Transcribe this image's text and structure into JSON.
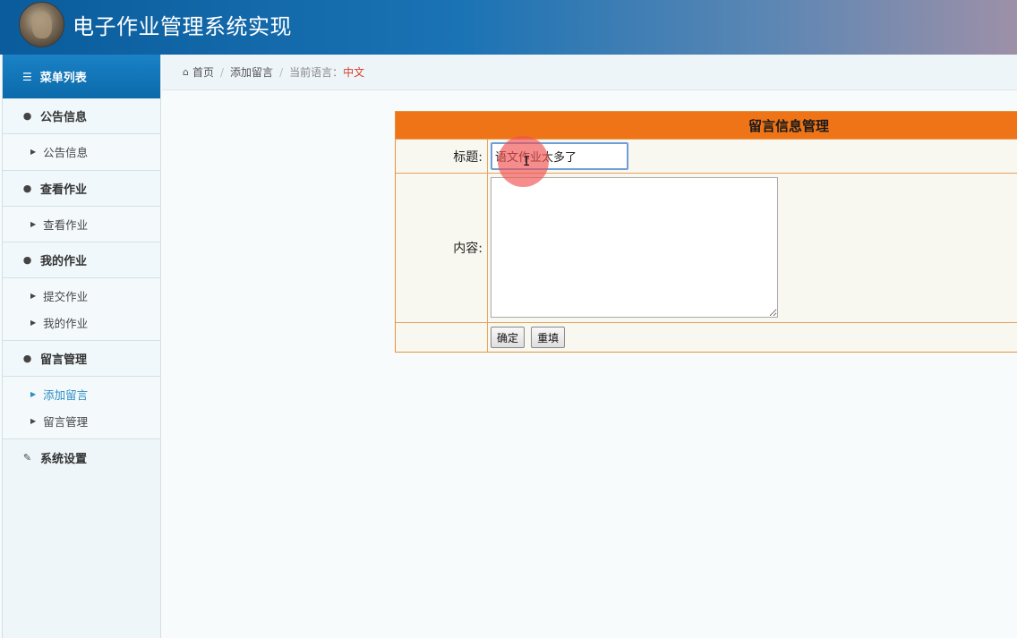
{
  "header": {
    "title": "电子作业管理系统实现"
  },
  "sidebar": {
    "menu_title": "菜单列表",
    "groups": [
      {
        "label": "公告信息",
        "items": [
          {
            "label": "公告信息"
          }
        ]
      },
      {
        "label": "查看作业",
        "items": [
          {
            "label": "查看作业"
          }
        ]
      },
      {
        "label": "我的作业",
        "items": [
          {
            "label": "提交作业"
          },
          {
            "label": "我的作业"
          }
        ]
      },
      {
        "label": "留言管理",
        "items": [
          {
            "label": "添加留言",
            "active": true
          },
          {
            "label": "留言管理"
          }
        ]
      },
      {
        "label": "系统设置",
        "items": []
      }
    ]
  },
  "breadcrumb": {
    "home": "首页",
    "current": "添加留言",
    "lang_label": "当前语言：",
    "lang_value": "中文"
  },
  "form": {
    "panel_title": "留言信息管理",
    "title_label": "标题:",
    "title_value": "语文作业太多了",
    "content_label": "内容:",
    "content_value": "",
    "submit_label": "确定",
    "reset_label": "重填"
  },
  "icons": {
    "menu": "list-icon",
    "group": "user-icon",
    "settings": "edit-icon",
    "home": "home-icon",
    "caret": "caret-right-icon"
  },
  "colors": {
    "header_start": "#0a5c9c",
    "menu_head": "#1a82c6",
    "panel_title_bg": "#ef7418",
    "panel_border": "#e7913b",
    "active_link": "#2b8cc4",
    "lang_value": "#d6402a"
  }
}
